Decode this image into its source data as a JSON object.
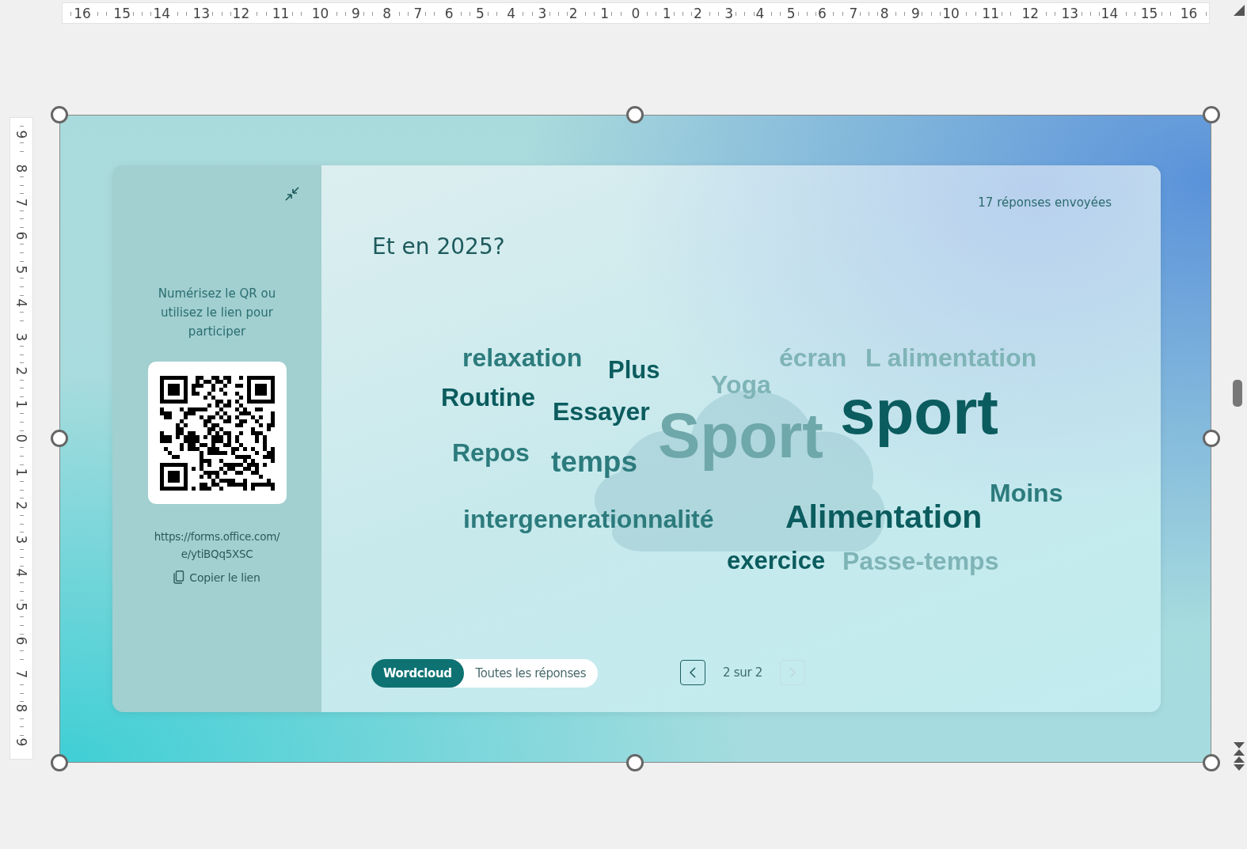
{
  "rulers": {
    "horizontal": [
      "16",
      "15",
      "14",
      "13",
      "12",
      "11",
      "10",
      "9",
      "8",
      "7",
      "6",
      "5",
      "4",
      "3",
      "2",
      "1",
      "0",
      "1",
      "2",
      "3",
      "4",
      "5",
      "6",
      "7",
      "8",
      "9",
      "10",
      "11",
      "12",
      "13",
      "14",
      "15",
      "16"
    ],
    "vertical": [
      "9",
      "8",
      "7",
      "6",
      "5",
      "4",
      "3",
      "2",
      "1",
      "0",
      "1",
      "2",
      "3",
      "4",
      "5",
      "6",
      "7",
      "8",
      "9"
    ]
  },
  "panel": {
    "instructions": "Numérisez le QR ou utilisez le lien pour participer",
    "link": "https://forms.office.com/e/ytiBQq5XSC",
    "copy_link": "Copier le lien"
  },
  "question": {
    "responses": "17 réponses envoyées",
    "title": "Et en 2025?"
  },
  "words": [
    {
      "text": "relaxation",
      "color": "#2c7b7d"
    },
    {
      "text": "Plus",
      "color": "#0b5c5e"
    },
    {
      "text": "écran",
      "color": "#7fb4b7"
    },
    {
      "text": "L alimentation",
      "color": "#7fb4b7"
    },
    {
      "text": "Routine",
      "color": "#0b5c5e"
    },
    {
      "text": "Essayer",
      "color": "#0b5c5e"
    },
    {
      "text": "Yoga",
      "color": "#7fb4b7"
    },
    {
      "text": "sport",
      "color": "#0b5c5e"
    },
    {
      "text": "Repos",
      "color": "#2c7b7d"
    },
    {
      "text": "temps",
      "color": "#2c7b7d"
    },
    {
      "text": "Sport",
      "color": "#6fa8aa"
    },
    {
      "text": "intergenerationnalité",
      "color": "#2c7b7d"
    },
    {
      "text": "Alimentation",
      "color": "#0b5c5e"
    },
    {
      "text": "Moins",
      "color": "#2c7b7d"
    },
    {
      "text": "exercice",
      "color": "#0b5c5e"
    },
    {
      "text": "Passe-temps",
      "color": "#7fb4b7"
    }
  ],
  "view_toggle": [
    {
      "label": "Wordcloud",
      "selected": true
    },
    {
      "label": "Toutes les réponses",
      "selected": false
    }
  ],
  "pager": {
    "previous_disabled": false,
    "text": "2 sur 2",
    "next_disabled": true
  }
}
